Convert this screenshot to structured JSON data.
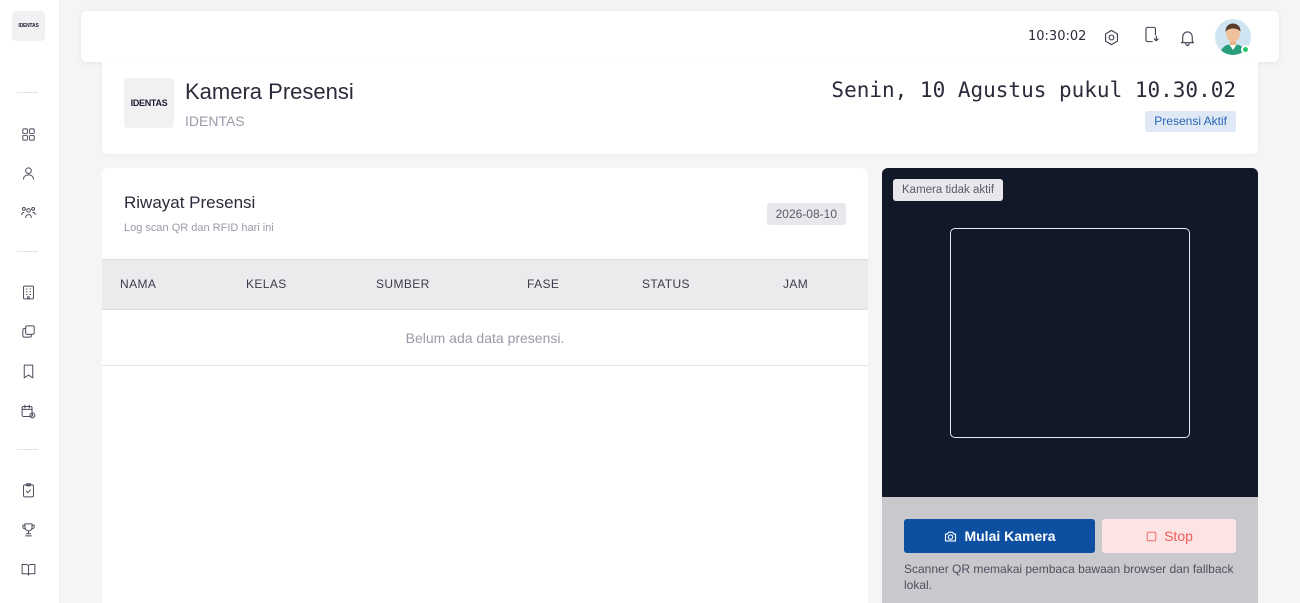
{
  "sidebar": {
    "logo_text": "IDENTAS",
    "items": [
      {
        "icon": "grid-icon"
      },
      {
        "icon": "user-icon"
      },
      {
        "icon": "users-group-icon"
      },
      {
        "icon": "building-icon"
      },
      {
        "icon": "copy-icon"
      },
      {
        "icon": "bookmark-icon"
      },
      {
        "icon": "calendar-clock-icon"
      },
      {
        "icon": "clipboard-check-icon"
      },
      {
        "icon": "trophy-icon"
      },
      {
        "icon": "book-open-icon"
      }
    ]
  },
  "topbar": {
    "time": "10:30:02",
    "icons": [
      "settings-icon",
      "device-download-icon",
      "bell-icon"
    ],
    "online_color": "#28c76f"
  },
  "header": {
    "logo_text": "IDENTAS",
    "title": "Kamera Presensi",
    "subtitle": "IDENTAS",
    "datetime": "Senin, 10 Agustus pukul 10.30.02",
    "status_badge": "Presensi Aktif"
  },
  "history": {
    "title": "Riwayat Presensi",
    "subtitle": "Log scan QR dan RFID hari ini",
    "date_badge": "2026-08-10",
    "columns": [
      "NAMA",
      "KELAS",
      "SUMBER",
      "FASE",
      "STATUS",
      "JAM"
    ],
    "empty_text": "Belum ada data presensi."
  },
  "camera": {
    "status_badge": "Kamera tidak aktif",
    "start_label": "Mulai Kamera",
    "stop_label": "Stop",
    "note": "Scanner QR memakai pembaca bawaan browser dan fallback lokal.",
    "primary_color": "#0d4fa0",
    "stop_color": "#f05a5a"
  }
}
